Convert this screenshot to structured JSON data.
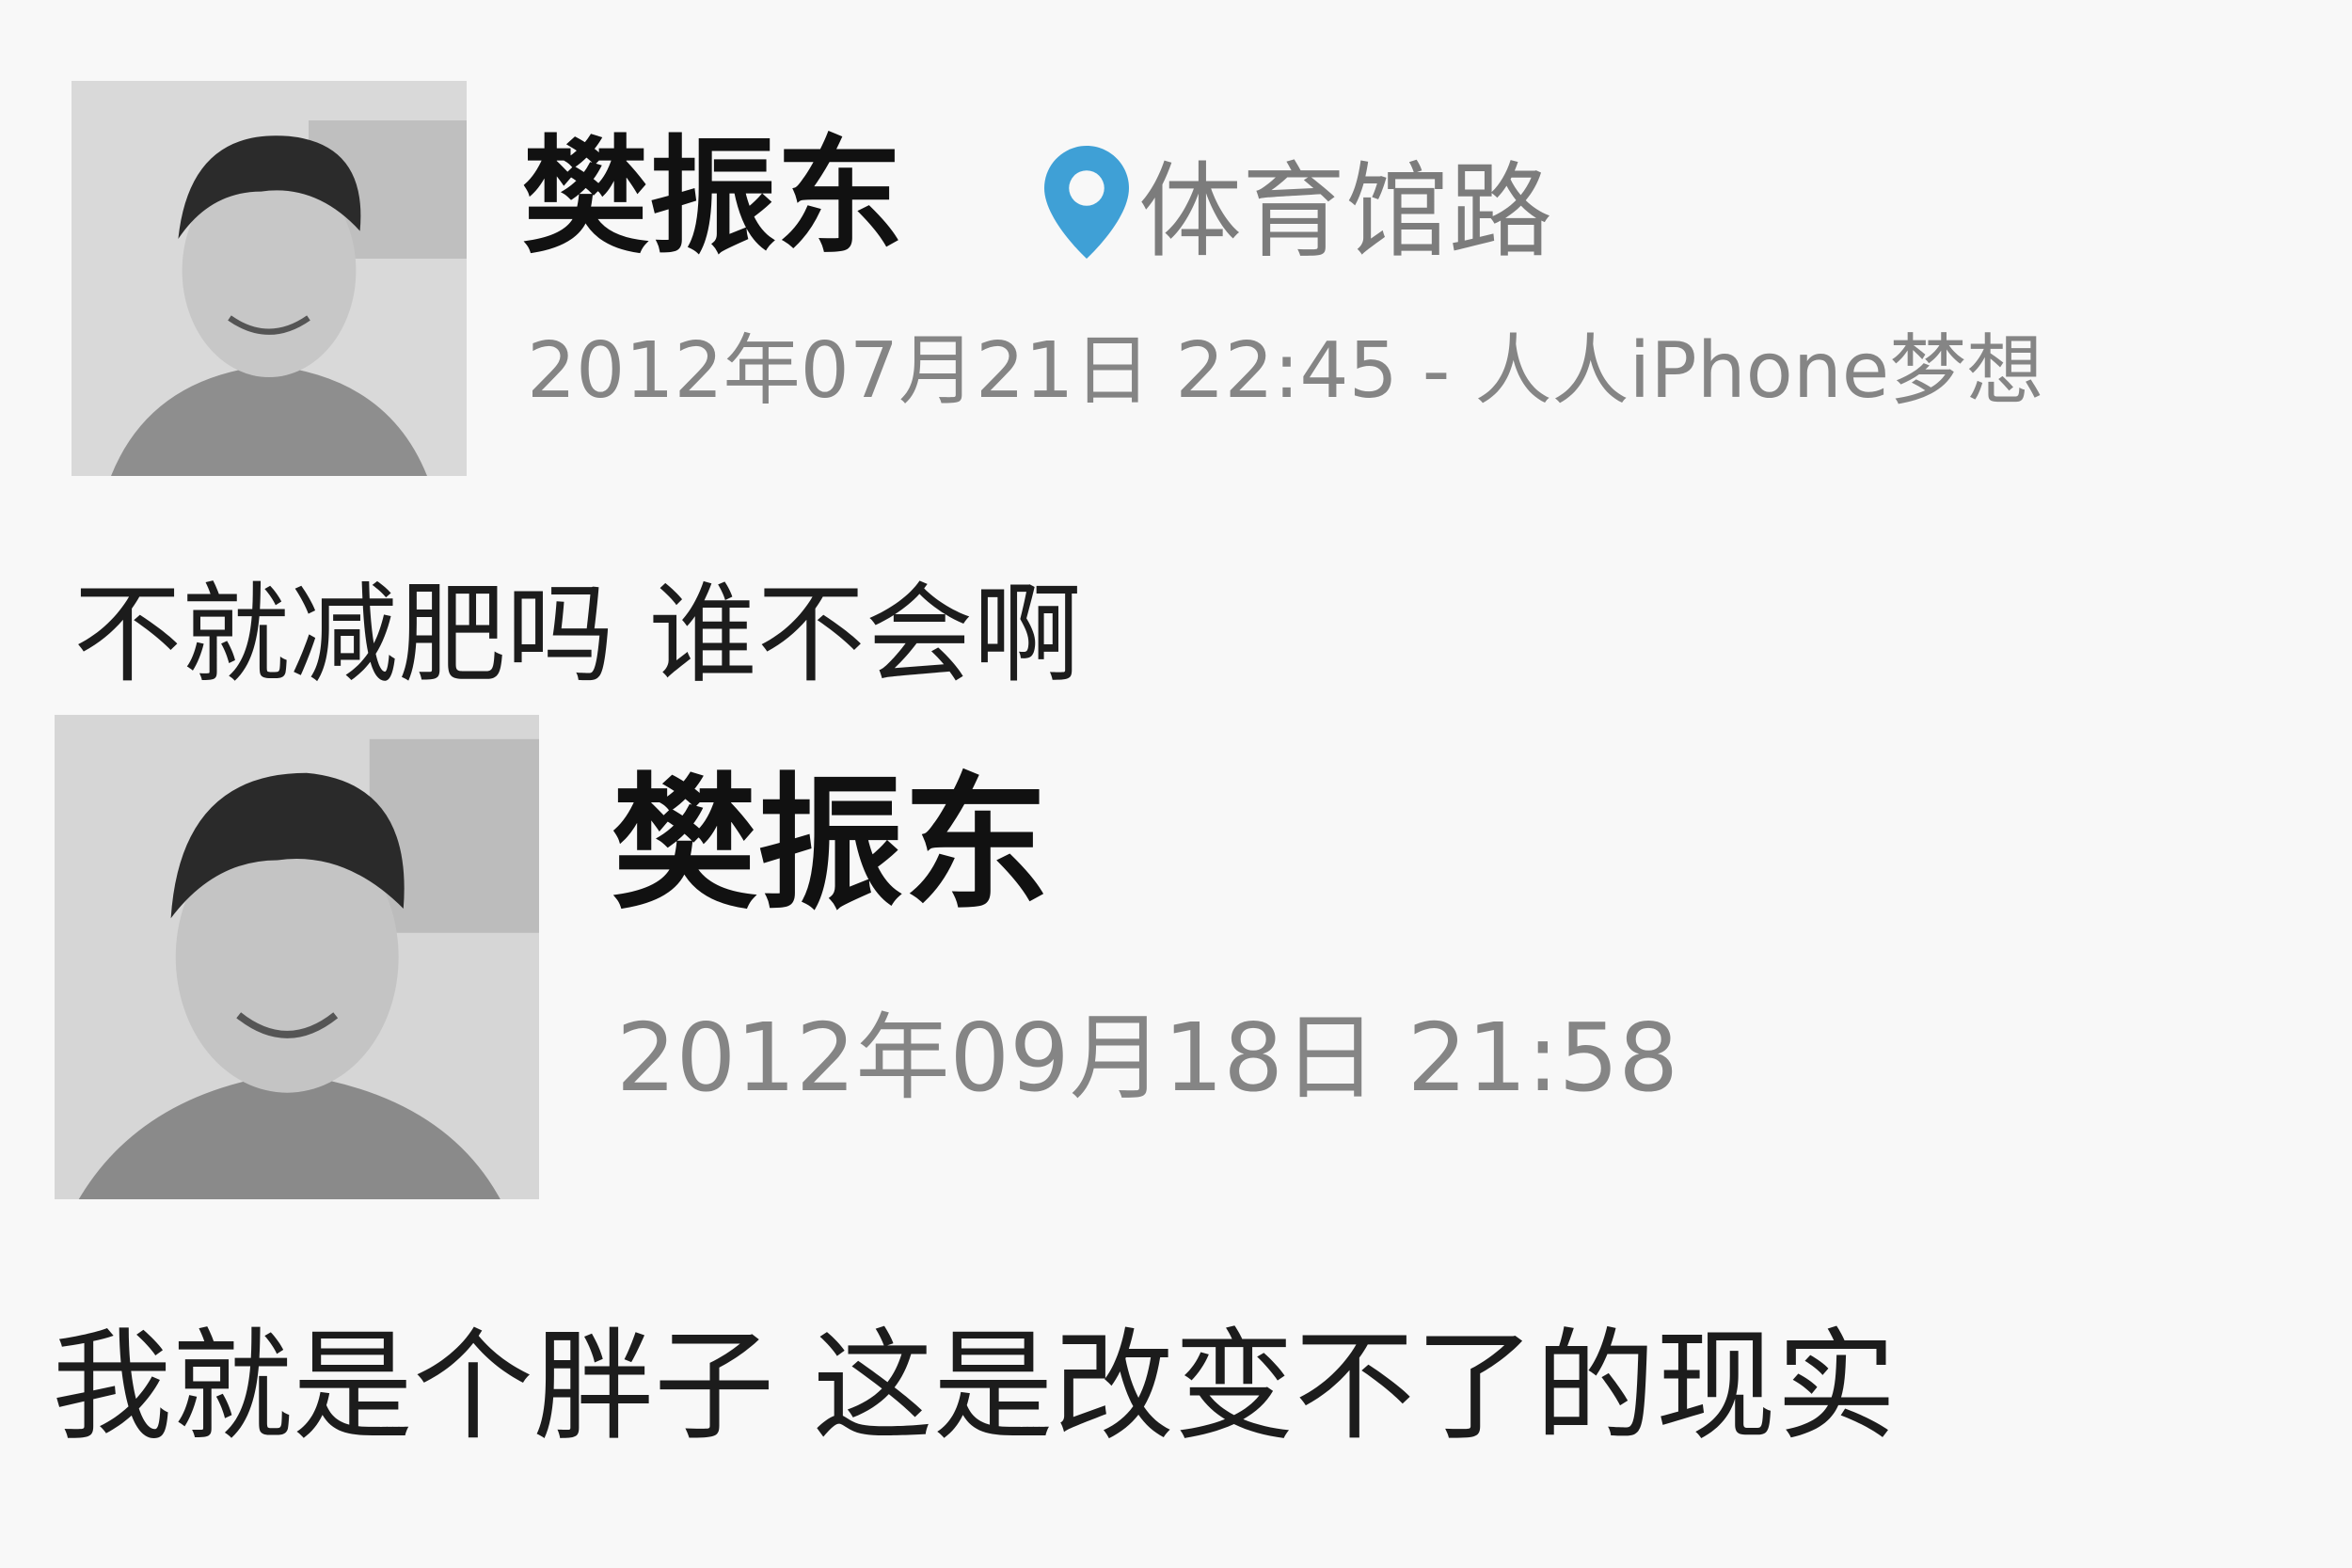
{
  "posts": [
    {
      "username": "樊振东",
      "location": "体育馆路",
      "timestamp": "2012年07月21日 22:45 - 人人iPhone梦想",
      "content": "不就减肥吗 谁不会啊",
      "icons": {
        "location": "location-pin-icon"
      }
    },
    {
      "username": "樊振东",
      "timestamp": "2012年09月18日 21:58",
      "content": "我就是个胖子 这是改变不了的现实"
    }
  ],
  "colors": {
    "background": "#f8f8f8",
    "pin": "#3fa0d6",
    "meta": "#858585"
  }
}
